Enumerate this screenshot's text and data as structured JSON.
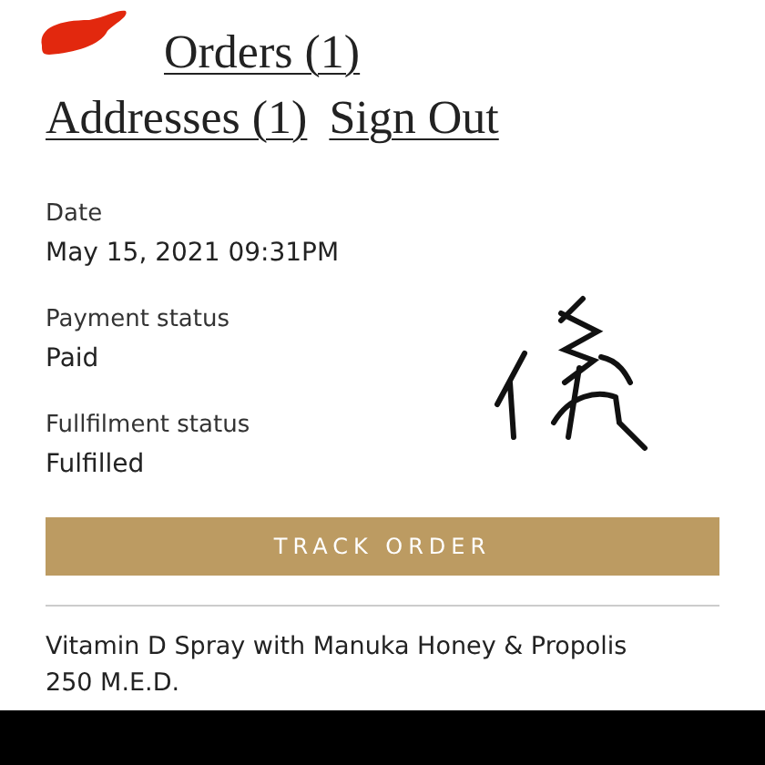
{
  "nav_links": [
    {
      "label": "Orders (1)"
    },
    {
      "label": "Addresses (1)"
    },
    {
      "label": "Sign Out"
    }
  ],
  "fields": [
    {
      "label": "Date",
      "value": "May 15, 2021 09:31PM"
    },
    {
      "label": "Payment status",
      "value": "Paid"
    },
    {
      "label": "Fullfilment status",
      "value": "Fulfilled"
    }
  ],
  "track_button": {
    "label": "TRACK ORDER"
  },
  "product": {
    "name": "Vitamin D Spray with Manuka Honey & Propolis 250 M.E.D."
  }
}
